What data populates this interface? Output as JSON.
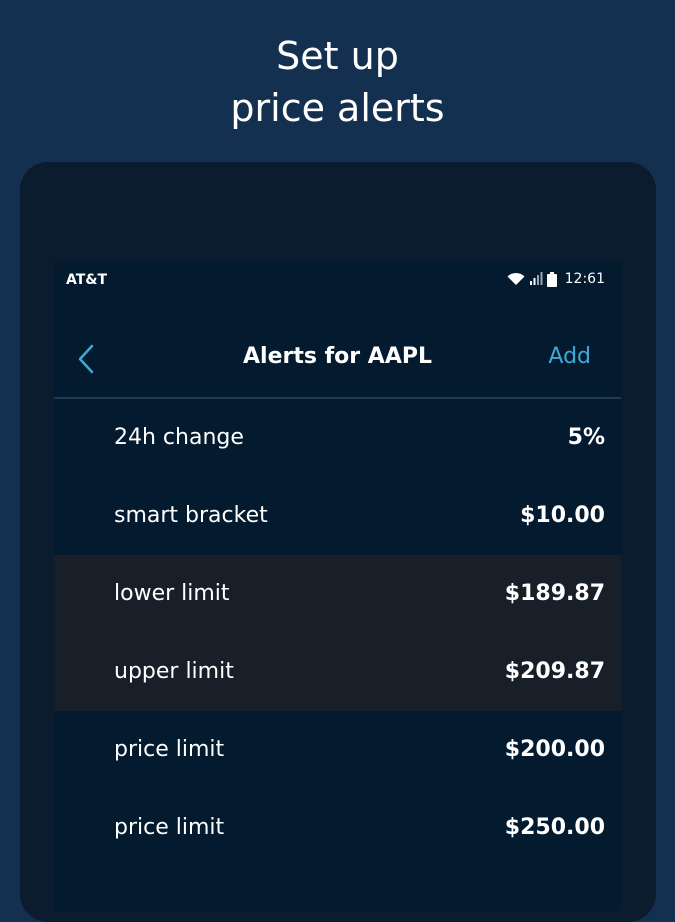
{
  "promo": {
    "title_line1": "Set up",
    "title_line2": "price alerts"
  },
  "status_bar": {
    "carrier": "AT&T",
    "time": "12:61",
    "icons": [
      "wifi-icon",
      "signal-icon",
      "battery-icon"
    ]
  },
  "nav": {
    "back_icon": "chevron-left-icon",
    "title": "Alerts for AAPL",
    "add_label": "Add"
  },
  "alerts": [
    {
      "label": "24h change",
      "value": "5%"
    },
    {
      "label": "smart bracket",
      "value": "$10.00"
    },
    {
      "label": "lower limit",
      "value": "$189.87"
    },
    {
      "label": "upper limit",
      "value": "$209.87"
    },
    {
      "label": "price limit",
      "value": "$200.00"
    },
    {
      "label": "price limit",
      "value": "$250.00"
    }
  ],
  "colors": {
    "background": "#143050",
    "screen": "#041a2f",
    "accent": "#3fa9d6",
    "highlight_row": "#181f28"
  }
}
